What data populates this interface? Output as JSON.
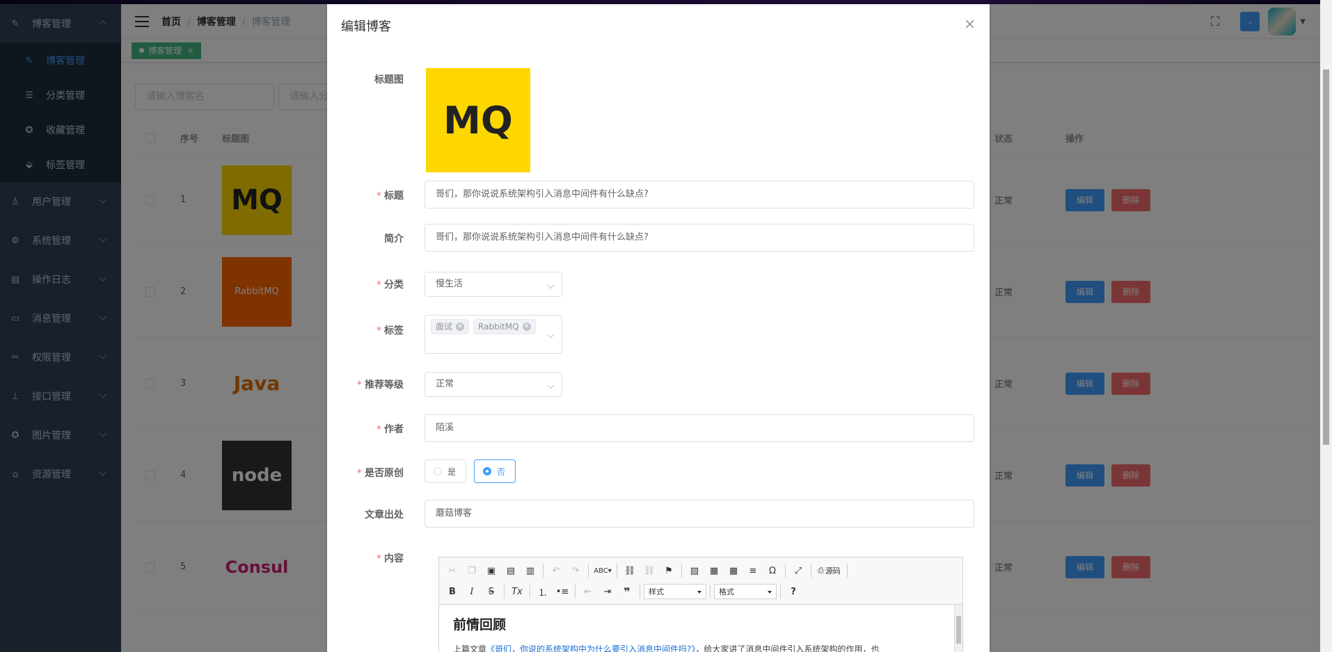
{
  "sidebar": {
    "groups": [
      {
        "label": "博客管理",
        "icon": "edit-icon",
        "expanded": true,
        "children": [
          {
            "label": "博客管理",
            "icon": "edit-icon",
            "active": true
          },
          {
            "label": "分类管理",
            "icon": "list-icon"
          },
          {
            "label": "收藏管理",
            "icon": "star-icon"
          },
          {
            "label": "标签管理",
            "icon": "tag-icon"
          }
        ]
      },
      {
        "label": "用户管理",
        "icon": "user-icon"
      },
      {
        "label": "系统管理",
        "icon": "gear-icon"
      },
      {
        "label": "操作日志",
        "icon": "log-icon"
      },
      {
        "label": "消息管理",
        "icon": "message-icon"
      },
      {
        "label": "权限管理",
        "icon": "key-icon"
      },
      {
        "label": "接口管理",
        "icon": "api-icon"
      },
      {
        "label": "图片管理",
        "icon": "picture-icon"
      },
      {
        "label": "资源管理",
        "icon": "resource-icon"
      }
    ]
  },
  "navbar": {
    "breadcrumb": [
      "首页",
      "博客管理",
      "博客管理"
    ],
    "fullscreen_icon": "fullscreen-icon"
  },
  "tags_view": {
    "active_tag": "博客管理",
    "close": "×"
  },
  "filters": {
    "blog_name_placeholder": "请输入博客名",
    "category_placeholder": "请输入分"
  },
  "table": {
    "headers": {
      "index": "序号",
      "image": "标题图",
      "status": "状态",
      "actions": "操作"
    },
    "rows": [
      {
        "index": "1",
        "image": "MQ",
        "status": "正常",
        "edit": "编辑",
        "delete": "删除"
      },
      {
        "index": "2",
        "image": "RabbitMQ",
        "status": "正常",
        "edit": "编辑",
        "delete": "删除"
      },
      {
        "index": "3",
        "image": "Java",
        "status": "正常",
        "edit": "编辑",
        "delete": "删除"
      },
      {
        "index": "4",
        "image": "node",
        "status": "正常",
        "edit": "编辑",
        "delete": "删除"
      },
      {
        "index": "5",
        "image": "Consul",
        "status": "正常",
        "edit": "编辑",
        "delete": "删除"
      }
    ]
  },
  "dialog": {
    "title": "编辑博客",
    "close": "×",
    "fields": {
      "cover_label": "标题图",
      "cover_text": "MQ",
      "title_label": "标题",
      "title_value": "哥们，那你说说系统架构引入消息中间件有什么缺点?",
      "summary_label": "简介",
      "summary_value": "哥们，那你说说系统架构引入消息中间件有什么缺点?",
      "category_label": "分类",
      "category_value": "慢生活",
      "tags_label": "标签",
      "tags": [
        "面试",
        "RabbitMQ"
      ],
      "level_label": "推荐等级",
      "level_value": "正常",
      "author_label": "作者",
      "author_value": "陌溪",
      "original_label": "是否原创",
      "original_yes": "是",
      "original_no": "否",
      "source_label": "文章出处",
      "source_value": "蘑菇博客",
      "content_label": "内容"
    },
    "editor": {
      "source_btn": "源码",
      "style_combo": "样式",
      "format_combo": "格式",
      "heading": "前情回顾",
      "para_prefix": "上篇文章",
      "para_link": "《哥们，你说的系统架构中为什么要引入消息中间件吗?》",
      "para_suffix": "，给大家讲了消息中间件引入系统架构的作用，也"
    }
  },
  "colors": {
    "primary": "#409eff",
    "danger": "#f56c6c",
    "sidebar": "#304156",
    "tag": "#42b983",
    "mq_yellow": "#ffd700"
  }
}
